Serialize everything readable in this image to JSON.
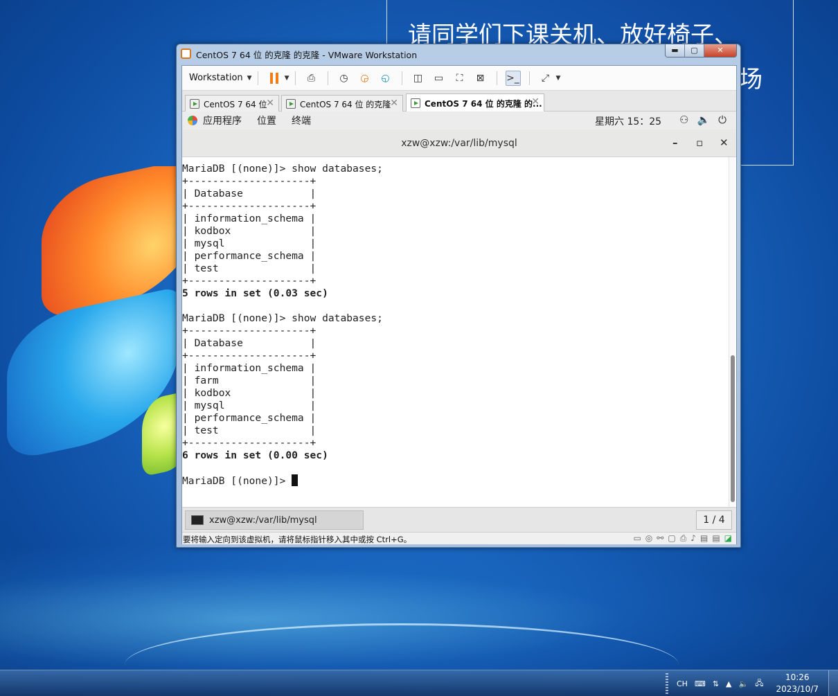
{
  "slide_note": {
    "line1": "请同学们下课关机、放好椅子、",
    "line2": "场"
  },
  "vmware": {
    "title": "CentOS 7 64 位 的克隆 的克隆 - VMware Workstation",
    "caption_buttons": {
      "minimize": "▬",
      "maximize": "▢",
      "close": "✕"
    },
    "toolbar": {
      "workstation_label": "Workstation"
    },
    "tabs": [
      {
        "label": "CentOS 7 64 位",
        "close": "✕"
      },
      {
        "label": "CentOS 7 64 位 的克隆",
        "close": "✕"
      },
      {
        "label": "CentOS 7 64 位 的克隆 的...",
        "close": "✕"
      }
    ],
    "status_text": "要将输入定向到该虚拟机，请将鼠标指针移入其中或按 Ctrl+G。"
  },
  "gnome": {
    "menus": [
      "应用程序",
      "位置",
      "终端"
    ],
    "clock": "星期六 15：25"
  },
  "terminal": {
    "title": "xzw@xzw:/var/lib/mysql",
    "controls": {
      "minimize": "–",
      "maximize": "▫",
      "close": "✕"
    },
    "lines": [
      "MariaDB [(none)]> show databases;",
      "+--------------------+",
      "| Database           |",
      "+--------------------+",
      "| information_schema |",
      "| kodbox             |",
      "| mysql              |",
      "| performance_schema |",
      "| test               |",
      "+--------------------+",
      "5 rows in set (0.03 sec)",
      "",
      "MariaDB [(none)]> show databases;",
      "+--------------------+",
      "| Database           |",
      "+--------------------+",
      "| information_schema |",
      "| farm               |",
      "| kodbox             |",
      "| mysql              |",
      "| performance_schema |",
      "| test               |",
      "+--------------------+",
      "6 rows in set (0.00 sec)",
      "",
      "MariaDB [(none)]> "
    ],
    "task_label": "xzw@xzw:/var/lib/mysql",
    "page_indicator": "1 / 4"
  },
  "taskbar": {
    "ime": "CH",
    "clock_time": "10:26",
    "clock_date": "2023/10/7"
  }
}
